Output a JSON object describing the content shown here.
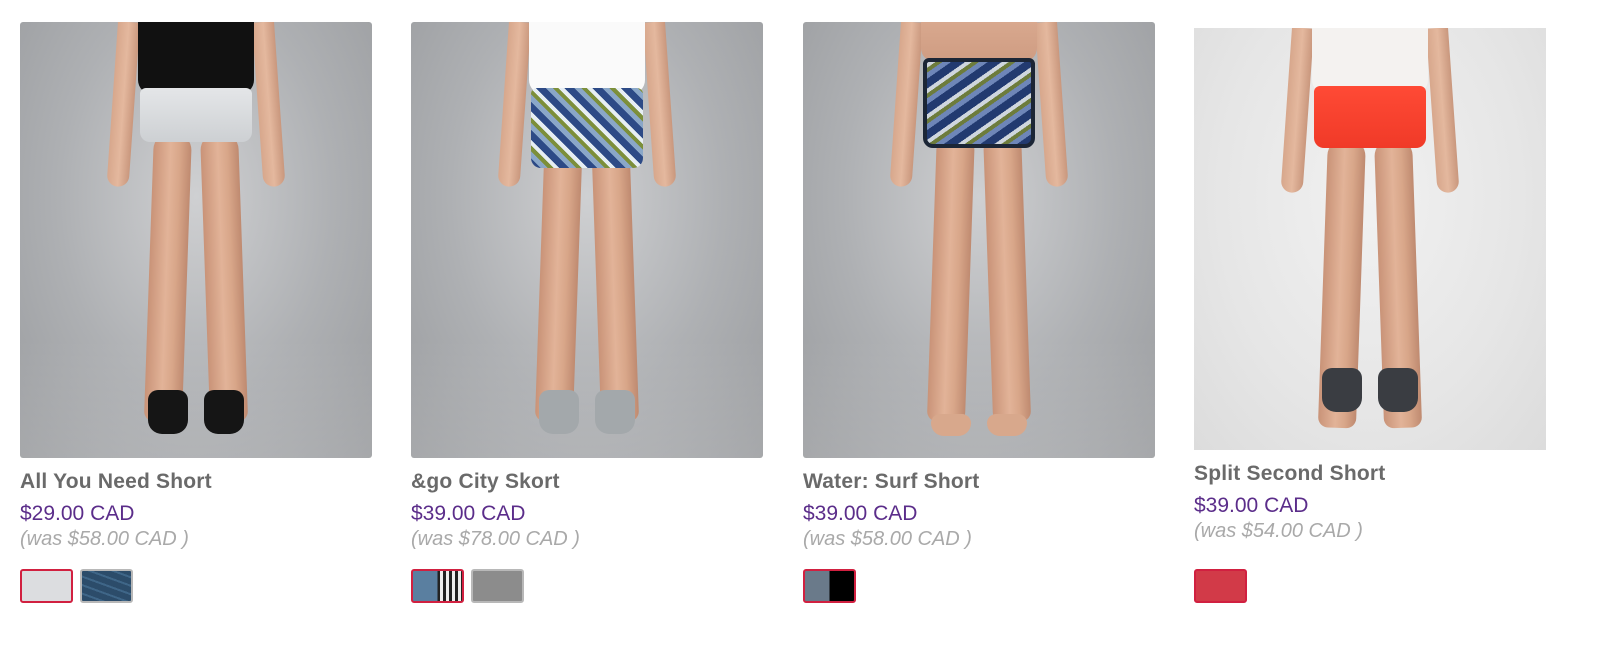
{
  "products": [
    {
      "name": "All You Need Short",
      "price": "$29.00 CAD",
      "was_price": "(was $58.00 CAD )",
      "image_alt": "All You Need Short",
      "swatches": [
        {
          "color": "#dcdde0",
          "selected": true
        },
        {
          "color": "#2c4c6a",
          "selected": false
        }
      ]
    },
    {
      "name": "&go City Skort",
      "price": "$39.00 CAD",
      "was_price": "(was $78.00 CAD )",
      "image_alt": "&go City Skort",
      "swatches": [
        {
          "color": "#5a7fa0",
          "selected": true
        },
        {
          "color": "#8c8c8c",
          "selected": false
        }
      ]
    },
    {
      "name": "Water: Surf Short",
      "price": "$39.00 CAD",
      "was_price": "(was $58.00 CAD )",
      "image_alt": "Water: Surf Short",
      "swatches": [
        {
          "color": "#6a7a8a",
          "selected": true
        }
      ]
    },
    {
      "name": "Split Second Short",
      "price": "$39.00 CAD",
      "was_price": "(was $54.00 CAD )",
      "image_alt": "Split Second Short",
      "swatches": [
        {
          "color": "#d23a48",
          "selected": true
        }
      ]
    }
  ],
  "colors": {
    "price": "#5b2d8a",
    "name": "#6a6a6a",
    "was_price": "#a9a9a9",
    "swatch_selected_border": "#d12040"
  }
}
